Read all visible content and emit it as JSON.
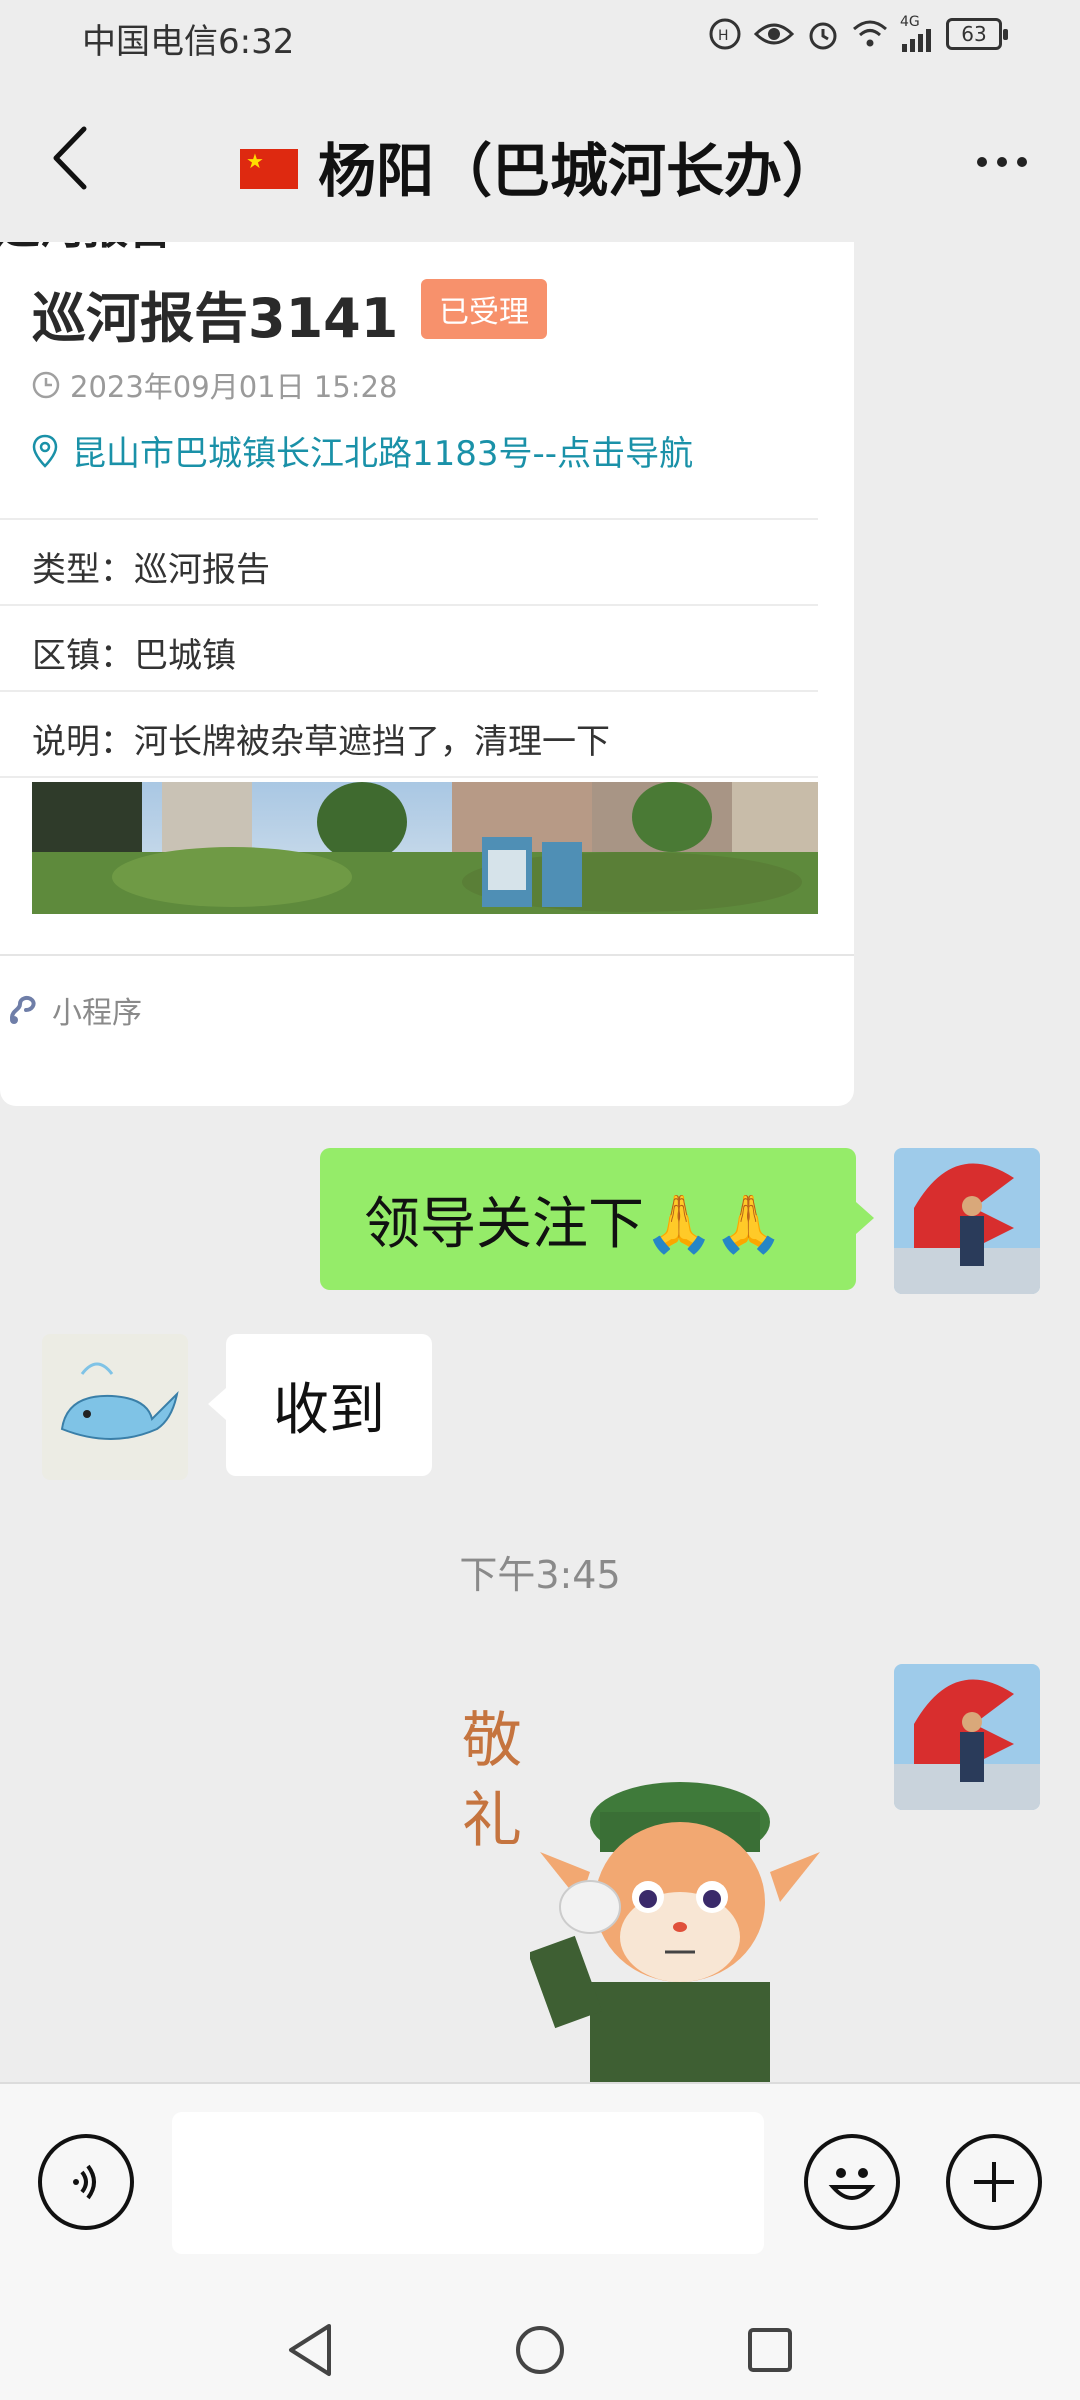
{
  "status_bar": {
    "carrier_time": "中国电信6:32",
    "network_label": "4G",
    "battery": "63"
  },
  "header": {
    "title": "杨阳（巴城河长办）"
  },
  "card": {
    "cut_title": "巡河报告",
    "report_title": "巡河报告3141",
    "badge": "已受理",
    "datetime": "2023年09月01日 15:28",
    "address": "昆山市巴城镇长江北路1183号--点击导航",
    "fields": [
      {
        "text": "类型：巡河报告"
      },
      {
        "text": "区镇：巴城镇"
      },
      {
        "text": "说明：河长牌被杂草遮挡了，清理一下"
      }
    ],
    "footer_label": "小程序"
  },
  "messages": {
    "outgoing_1": "领导关注下🙏🙏",
    "incoming_1": "收到",
    "timestamp": "下午3:45",
    "sticker_text_1": "敬",
    "sticker_text_2": "礼"
  },
  "colors": {
    "outgoing_bubble": "#95ec69",
    "incoming_bubble": "#ffffff",
    "badge": "#f7916c",
    "address_link": "#1a91a8",
    "background": "#ededed"
  },
  "icons": [
    "back-chevron-icon",
    "more-icon",
    "clock-icon",
    "location-pin-icon",
    "mini-program-icon",
    "voice-icon",
    "emoji-icon",
    "plus-icon",
    "nav-back-icon",
    "nav-home-icon",
    "nav-recents-icon"
  ]
}
